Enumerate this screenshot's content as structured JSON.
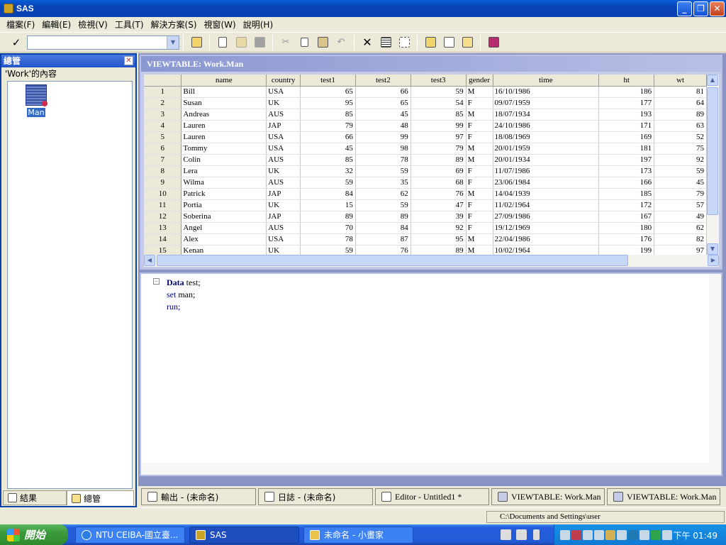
{
  "window": {
    "title": "SAS"
  },
  "menu": [
    "檔案(F)",
    "編輯(E)",
    "檢視(V)",
    "工具(T)",
    "解決方案(S)",
    "視窗(W)",
    "說明(H)"
  ],
  "command": {
    "value": ""
  },
  "left_panel": {
    "title": "總管",
    "subtitle": "'Work'的內容",
    "members": [
      {
        "label": "Man"
      }
    ],
    "tabs": [
      "結果",
      "總管"
    ]
  },
  "viewtable": {
    "title": "VIEWTABLE: Work.Man",
    "columns": [
      "name",
      "country",
      "test1",
      "test2",
      "test3",
      "gender",
      "time",
      "ht",
      "wt"
    ],
    "rows": [
      [
        "1",
        "Bill",
        "USA",
        "65",
        "66",
        "59",
        "M",
        "16/10/1986",
        "186",
        "81"
      ],
      [
        "2",
        "Susan",
        "UK",
        "95",
        "65",
        "54",
        "F",
        "09/07/1959",
        "177",
        "64"
      ],
      [
        "3",
        "Andreas",
        "AUS",
        "85",
        "45",
        "85",
        "M",
        "18/07/1934",
        "193",
        "89"
      ],
      [
        "4",
        "Lauren",
        "JAP",
        "79",
        "48",
        "99",
        "F",
        "24/10/1986",
        "171",
        "63"
      ],
      [
        "5",
        "Lauren",
        "USA",
        "66",
        "99",
        "97",
        "F",
        "18/08/1969",
        "169",
        "52"
      ],
      [
        "6",
        "Tommy",
        "USA",
        "45",
        "98",
        "79",
        "M",
        "20/01/1959",
        "181",
        "75"
      ],
      [
        "7",
        "Colin",
        "AUS",
        "85",
        "78",
        "89",
        "M",
        "20/01/1934",
        "197",
        "92"
      ],
      [
        "8",
        "Lera",
        "UK",
        "32",
        "59",
        "69",
        "F",
        "11/07/1986",
        "173",
        "59"
      ],
      [
        "9",
        "Wilma",
        "AUS",
        "59",
        "35",
        "68",
        "F",
        "23/06/1984",
        "166",
        "45"
      ],
      [
        "10",
        "Patrick",
        "JAP",
        "84",
        "62",
        "76",
        "M",
        "14/04/1939",
        "185",
        "79"
      ],
      [
        "11",
        "Portia",
        "UK",
        "15",
        "59",
        "47",
        "F",
        "11/02/1964",
        "172",
        "57"
      ],
      [
        "12",
        "Soberina",
        "JAP",
        "89",
        "89",
        "39",
        "F",
        "27/09/1986",
        "167",
        "49"
      ],
      [
        "13",
        "Angel",
        "AUS",
        "70",
        "84",
        "92",
        "F",
        "19/12/1969",
        "180",
        "62"
      ],
      [
        "14",
        "Alex",
        "USA",
        "78",
        "87",
        "95",
        "M",
        "22/04/1986",
        "176",
        "82"
      ],
      [
        "15",
        "Kenan",
        "UK",
        "59",
        "76",
        "89",
        "M",
        "10/02/1964",
        "199",
        "97"
      ]
    ]
  },
  "editor": {
    "line1_kw": "Data",
    "line1_rest": " test;",
    "line2_kw": "set",
    "line2_rest": " man;",
    "line3_kw": "run;"
  },
  "doc_tabs": [
    "輸出 - (未命名)",
    "日誌 - (未命名)",
    "Editor - Untitled1 *",
    "VIEWTABLE: Work.Man",
    "VIEWTABLE: Work.Man"
  ],
  "status": {
    "path": "C:\\Documents and Settings\\user"
  },
  "taskbar": {
    "start": "開始",
    "tasks": [
      "NTU CEIBA-國立臺...",
      "SAS",
      "未命名 - 小畫家"
    ],
    "clock": "下午 01:49"
  }
}
